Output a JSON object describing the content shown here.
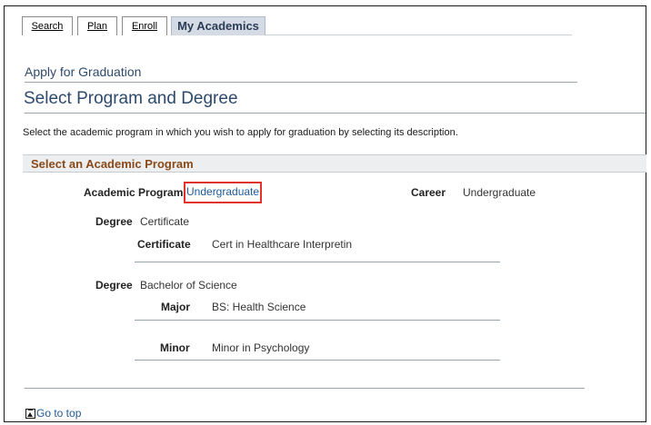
{
  "tabs": [
    {
      "label": "Search"
    },
    {
      "label": "Plan"
    },
    {
      "label": "Enroll"
    },
    {
      "label": "My Academics"
    }
  ],
  "page": {
    "subtitle": "Apply for Graduation",
    "title": "Select Program and Degree",
    "instructions": "Select the academic program in which you wish to apply for graduation by selecting its description."
  },
  "section": {
    "title": "Select an Academic Program",
    "program_label": "Academic Program",
    "program_link": "Undergraduate",
    "career_label": "Career",
    "career_value": "Undergraduate",
    "degrees": [
      {
        "label": "Degree",
        "value": "Certificate",
        "fields": [
          {
            "label": "Certificate",
            "value": "Cert in Healthcare Interpretin"
          }
        ]
      },
      {
        "label": "Degree",
        "value": "Bachelor of Science",
        "fields": [
          {
            "label": "Major",
            "value": "BS: Health Science"
          },
          {
            "label": "Minor",
            "value": "Minor in Psychology"
          }
        ]
      }
    ]
  },
  "footer": {
    "goto_top": "Go to top"
  },
  "colors": {
    "link": "#1f5a96",
    "section_title": "#8a4a1a",
    "highlight_box": "#e0332a",
    "active_tab_bg": "#d4dbe5"
  }
}
